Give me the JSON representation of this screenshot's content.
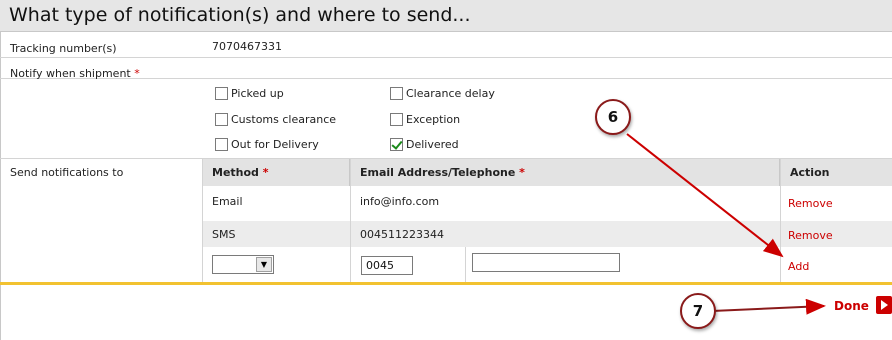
{
  "header": {
    "title": "What type of notification(s) and where to send..."
  },
  "tracking": {
    "label": "Tracking number(s)",
    "value": "7070467331"
  },
  "notify": {
    "label": "Notify when shipment",
    "required_mark": "*",
    "options": [
      {
        "label": "Picked up",
        "checked": false
      },
      {
        "label": "Customs clearance",
        "checked": false
      },
      {
        "label": "Out for Delivery",
        "checked": false
      },
      {
        "label": "Clearance delay",
        "checked": false
      },
      {
        "label": "Exception",
        "checked": false
      },
      {
        "label": "Delivered",
        "checked": true
      }
    ]
  },
  "send": {
    "label": "Send notifications to",
    "columns": {
      "method": "Method",
      "address": "Email Address/Telephone",
      "action": "Action",
      "required_mark": "*"
    },
    "rows": [
      {
        "method": "Email",
        "address": "info@info.com",
        "action": "Remove"
      },
      {
        "method": "SMS",
        "address": "004511223344",
        "action": "Remove"
      }
    ],
    "new_row": {
      "method_value": "",
      "prefix_value": "0045",
      "number_value": "",
      "action": "Add"
    }
  },
  "footer": {
    "done_label": "Done"
  },
  "callouts": {
    "six": "6",
    "seven": "7"
  },
  "colors": {
    "accent_red": "#cc0000",
    "divider_yellow": "#f2c230",
    "header_bg": "#e6e6e6"
  }
}
